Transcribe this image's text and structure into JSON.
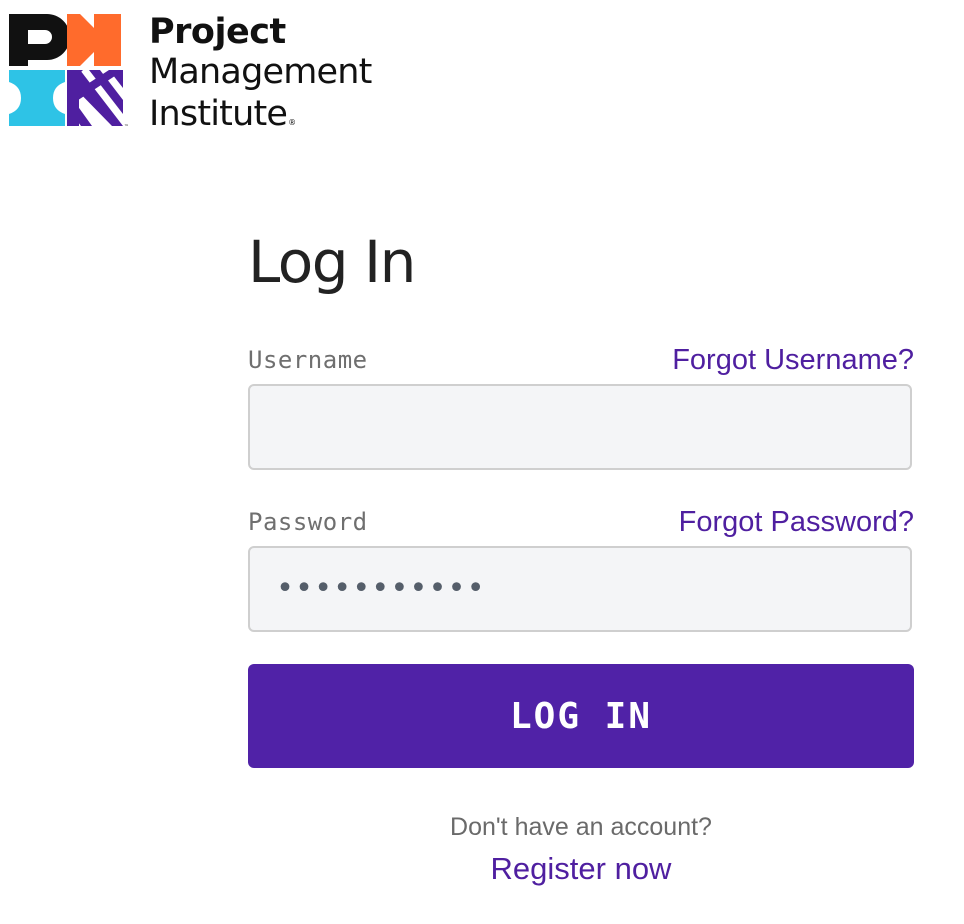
{
  "brand": {
    "logo_icon": "pmi-logo-icon",
    "line1": "Project",
    "line2": "Management",
    "line3": "Institute",
    "trademark": "™",
    "registered": "®",
    "colors": {
      "black": "#111111",
      "orange": "#ff6b2c",
      "cyan": "#2ec3e6",
      "purple": "#4f1fa0"
    }
  },
  "login": {
    "title": "Log In",
    "username_label": "Username",
    "forgot_username": "Forgot Username?",
    "username_value": "",
    "password_label": "Password",
    "forgot_password": "Forgot Password?",
    "password_value": "•••••••••••",
    "submit_label": "LOG IN",
    "no_account_text": "Don't have an account?",
    "register_label": "Register now"
  },
  "colors": {
    "accent": "#5022a7",
    "link": "#4f1fa0",
    "input_bg": "#f4f5f7",
    "input_border": "#cfcfcf"
  }
}
